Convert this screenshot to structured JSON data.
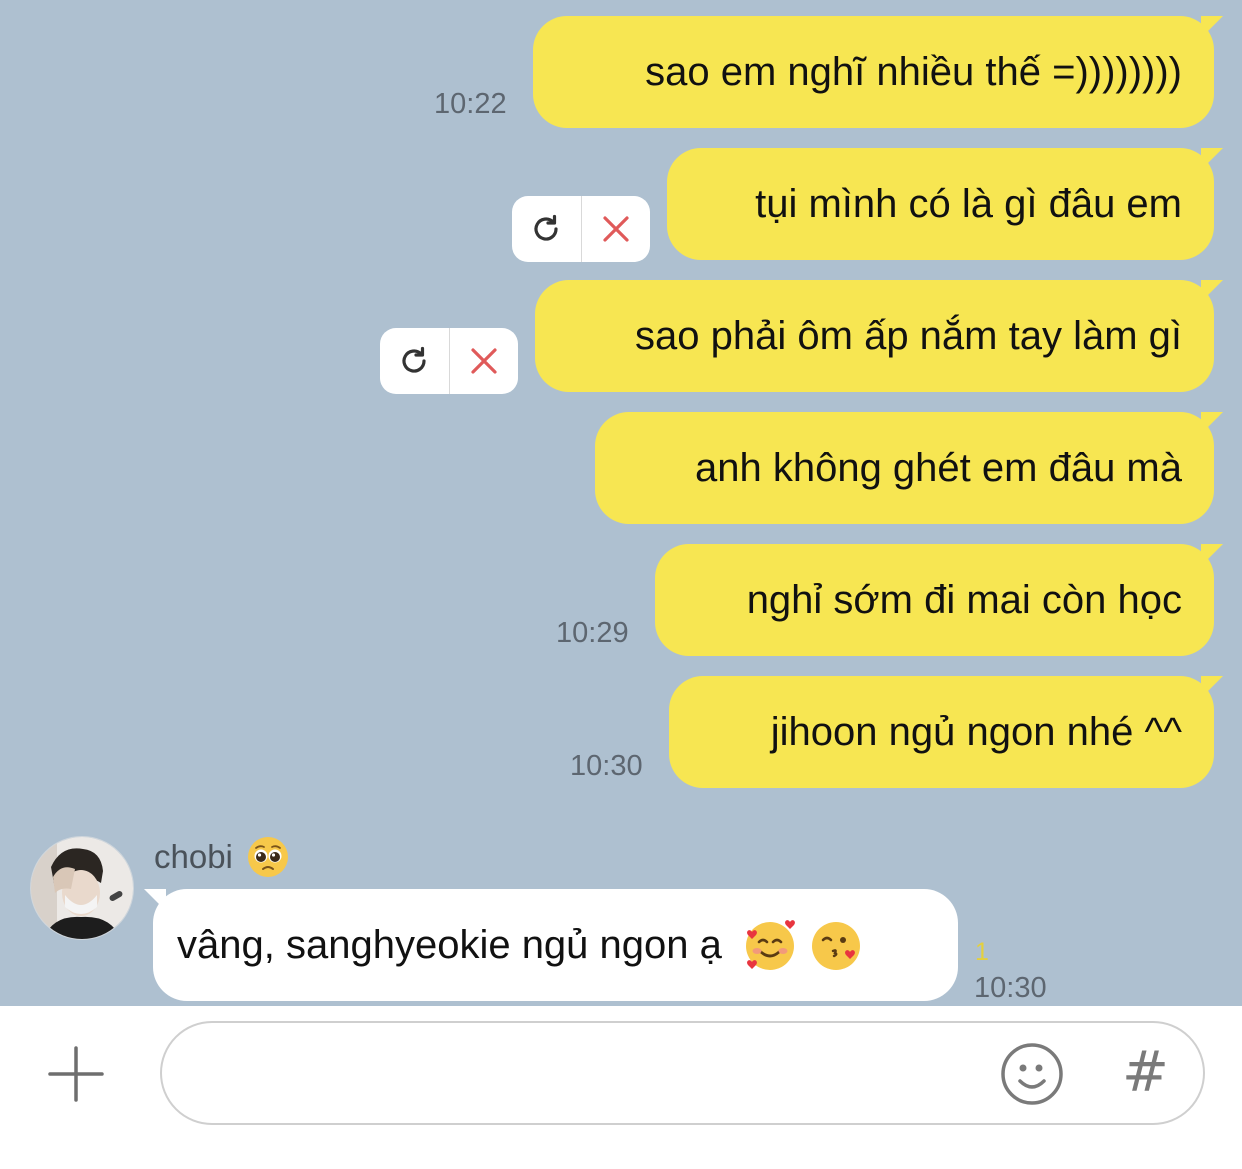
{
  "messages_out": [
    {
      "text": "sao em nghĩ nhiều thế =))))))))",
      "time": "10:22"
    },
    {
      "text": "tụi mình có là gì đâu em",
      "failed": true
    },
    {
      "text": "sao phải ôm ấp nắm tay làm gì",
      "failed": true
    },
    {
      "text": "anh không ghét em đâu mà"
    },
    {
      "text": "nghỉ sớm đi mai còn học",
      "time": "10:29"
    },
    {
      "text": "jihoon ngủ ngon nhé ^^",
      "time": "10:30"
    }
  ],
  "incoming": {
    "sender": "chobi",
    "sender_emoji": "pleading-face",
    "text": "vâng, sanghyeokie ngủ ngon ạ",
    "emojis": [
      "smiling-face-with-hearts",
      "face-blowing-kiss"
    ],
    "unread_count": "1",
    "time": "10:30"
  },
  "input": {
    "placeholder": "",
    "hash_label": "#"
  },
  "colors": {
    "chat_background": "#aec0d0",
    "outgoing_bubble": "#f7e652",
    "incoming_bubble": "#ffffff",
    "failed_x": "#e05a5a",
    "unread": "#e4d03e"
  }
}
